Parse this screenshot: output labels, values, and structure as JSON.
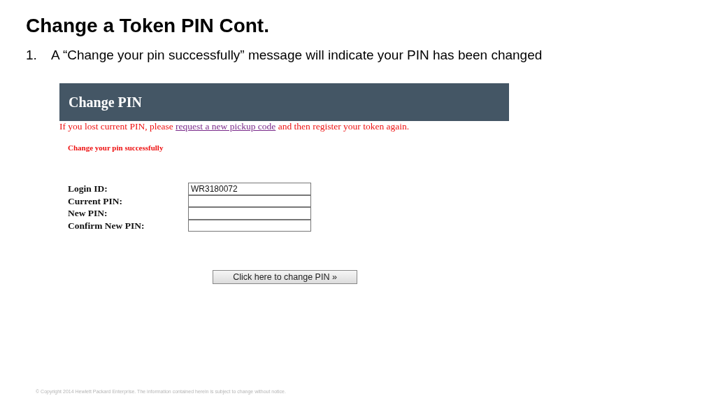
{
  "title": "Change a Token PIN Cont.",
  "steps": [
    {
      "number": "1.",
      "text": "A “Change your pin successfully” message will indicate your PIN has been changed"
    }
  ],
  "screenshot": {
    "heading": "Change PIN",
    "notice": {
      "before": "If you lost current PIN, please ",
      "link": "request a new pickup code",
      "after": " and then register your token again."
    },
    "status": "Change your pin successfully",
    "fields": [
      {
        "label": "Login ID:",
        "value": "WR3180072"
      },
      {
        "label": "Current PIN:"
      },
      {
        "label": "New PIN:"
      },
      {
        "label": "Confirm New PIN:"
      }
    ],
    "submit": "Click here to change PIN »"
  },
  "footer": "© Copyright 2014 Hewlett Packard Enterprise.  The information contained herein is subject to change without notice."
}
